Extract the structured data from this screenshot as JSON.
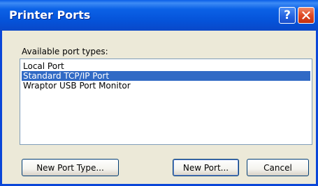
{
  "window": {
    "title": "Printer Ports",
    "help_icon": "?",
    "close_icon": "close-x"
  },
  "ports": {
    "label": "Available port types:",
    "items": [
      {
        "label": "Local Port",
        "selected": false
      },
      {
        "label": "Standard TCP/IP Port",
        "selected": true
      },
      {
        "label": "Wraptor USB Port Monitor",
        "selected": false
      }
    ]
  },
  "buttons": {
    "new_port_type": "New Port Type...",
    "new_port": "New Port...",
    "cancel": "Cancel"
  },
  "colors": {
    "titlebar": "#0552d8",
    "selection": "#316ac5",
    "dialog_bg": "#ece9d8"
  }
}
